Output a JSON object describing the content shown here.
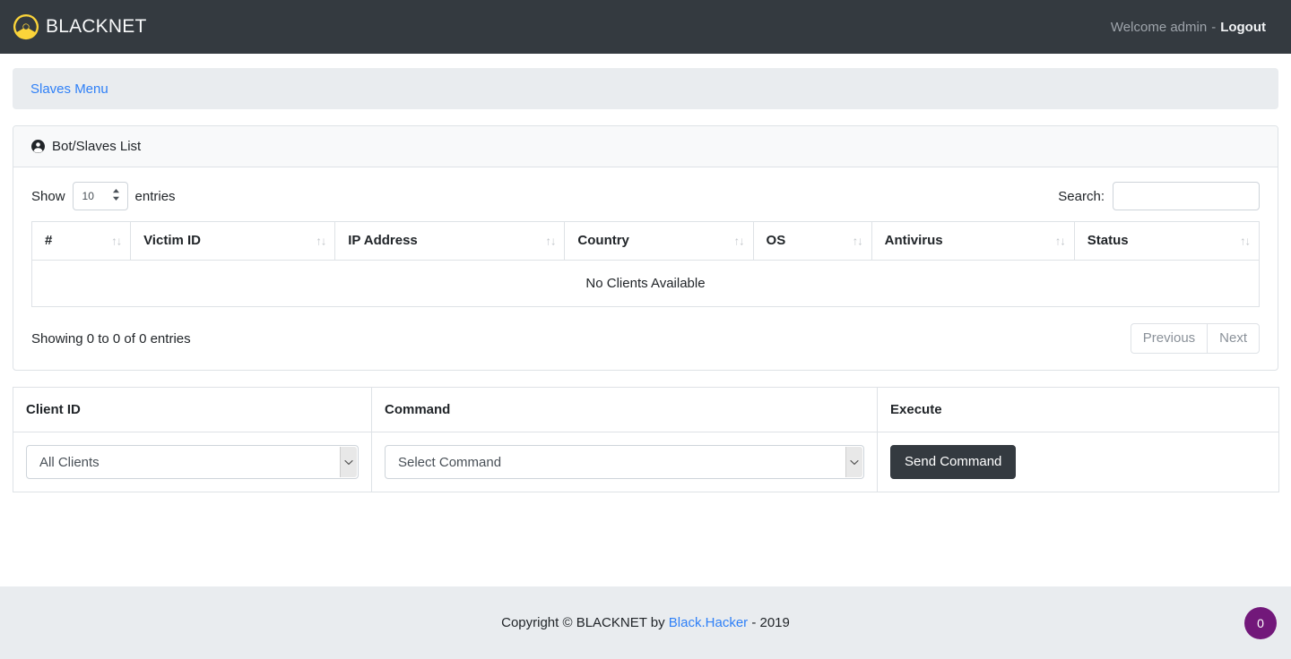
{
  "navbar": {
    "brand": "BLACKNET",
    "logo_icon": "radiation-icon",
    "welcome_text": "Welcome admin",
    "separator": "-",
    "logout_label": "Logout"
  },
  "breadcrumb": {
    "link_label": "Slaves Menu"
  },
  "card": {
    "header_icon": "user-circle-icon",
    "header_title": "Bot/Slaves List"
  },
  "datatable": {
    "length_label_before": "Show",
    "length_value": "10",
    "length_label_after": "entries",
    "search_label": "Search:",
    "search_value": "",
    "search_placeholder": "",
    "sort_icon": "↑↓",
    "columns": [
      "#",
      "Victim ID",
      "IP Address",
      "Country",
      "OS",
      "Antivirus",
      "Status"
    ],
    "empty_message": "No Clients Available",
    "info_text": "Showing 0 to 0 of 0 entries",
    "pagination": {
      "previous_label": "Previous",
      "next_label": "Next"
    }
  },
  "command_panel": {
    "headers": [
      "Client ID",
      "Command",
      "Execute"
    ],
    "client_select_value": "All Clients",
    "command_select_value": "Select Command",
    "send_button_label": "Send Command"
  },
  "footer": {
    "text_before": "Copyright © BLACKNET by",
    "link_label": "Black.Hacker",
    "text_after": "- 2019",
    "badge_count": "0"
  },
  "colors": {
    "navbar_bg": "#343a40",
    "accent_link": "#2f80f7",
    "logo_yellow": "#fbd43a",
    "badge_purple": "#72187a",
    "panel_bg": "#e9ecef"
  }
}
